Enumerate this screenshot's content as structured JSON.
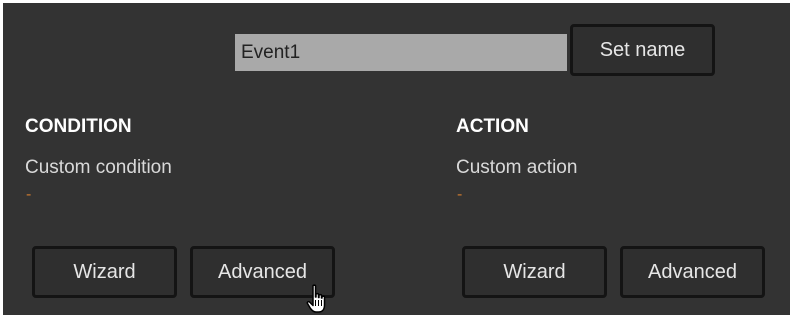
{
  "event": {
    "name_value": "Event1",
    "set_name_label": "Set name"
  },
  "condition": {
    "heading": "CONDITION",
    "description": "Custom condition",
    "detail": "-",
    "wizard_label": "Wizard",
    "advanced_label": "Advanced"
  },
  "action": {
    "heading": "ACTION",
    "description": "Custom action",
    "detail": "-",
    "wizard_label": "Wizard",
    "advanced_label": "Advanced"
  },
  "cursor": {
    "icon": "hand-pointer-icon"
  },
  "colors": {
    "panel_background": "#333333",
    "button_background": "#2f2f2f",
    "button_border": "#141414",
    "input_background": "#a9a9a9",
    "detail_accent": "#c8782f"
  }
}
